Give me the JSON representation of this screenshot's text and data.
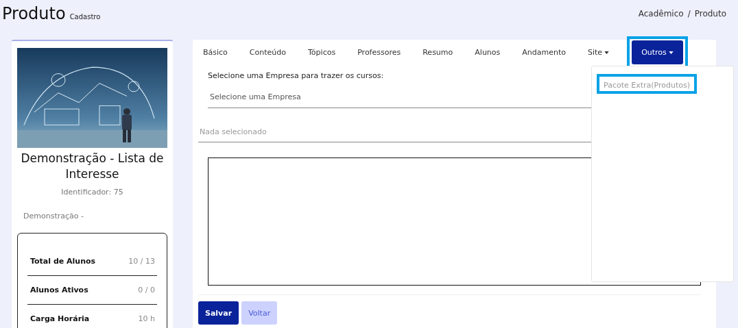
{
  "header": {
    "title": "Produto",
    "subtitle": "Cadastro",
    "breadcrumb": [
      "Acadêmico",
      "Produto"
    ],
    "breadcrumb_separator": "/"
  },
  "sidebar": {
    "name": "Demonstração - Lista de Interesse",
    "identifier": "Identificador: 75",
    "category": "Demonstração -",
    "stats": [
      {
        "label": "Total de Alunos",
        "value": "10 / 13"
      },
      {
        "label": "Alunos Ativos",
        "value": "0 / 0"
      },
      {
        "label": "Carga Horária",
        "value": "10 h"
      }
    ]
  },
  "tabs": [
    {
      "label": "Básico",
      "selected": false,
      "dropdown": false,
      "highlighted": false
    },
    {
      "label": "Conteúdo",
      "selected": false,
      "dropdown": false,
      "highlighted": false
    },
    {
      "label": "Tópicos",
      "selected": false,
      "dropdown": false,
      "highlighted": false
    },
    {
      "label": "Professores",
      "selected": false,
      "dropdown": false,
      "highlighted": false
    },
    {
      "label": "Resumo",
      "selected": false,
      "dropdown": false,
      "highlighted": false
    },
    {
      "label": "Alunos",
      "selected": false,
      "dropdown": false,
      "highlighted": false
    },
    {
      "label": "Andamento",
      "selected": false,
      "dropdown": false,
      "highlighted": false
    },
    {
      "label": "Site",
      "selected": false,
      "dropdown": true,
      "highlighted": false
    },
    {
      "label": "Outros",
      "selected": true,
      "dropdown": true,
      "highlighted": true
    }
  ],
  "dropdown_menu": {
    "items": [
      {
        "label": "Pacote Extra(Produtos)",
        "highlighted": true
      }
    ]
  },
  "form": {
    "company_label": "Selecione uma Empresa para trazer os cursos:",
    "company_select": {
      "placeholder": "Selecione uma Empresa"
    },
    "course_select": {
      "placeholder": "Nada selecionado"
    }
  },
  "buttons": [
    {
      "label": "Salvar",
      "kind": "primary"
    },
    {
      "label": "Voltar",
      "kind": "secondary"
    }
  ]
}
